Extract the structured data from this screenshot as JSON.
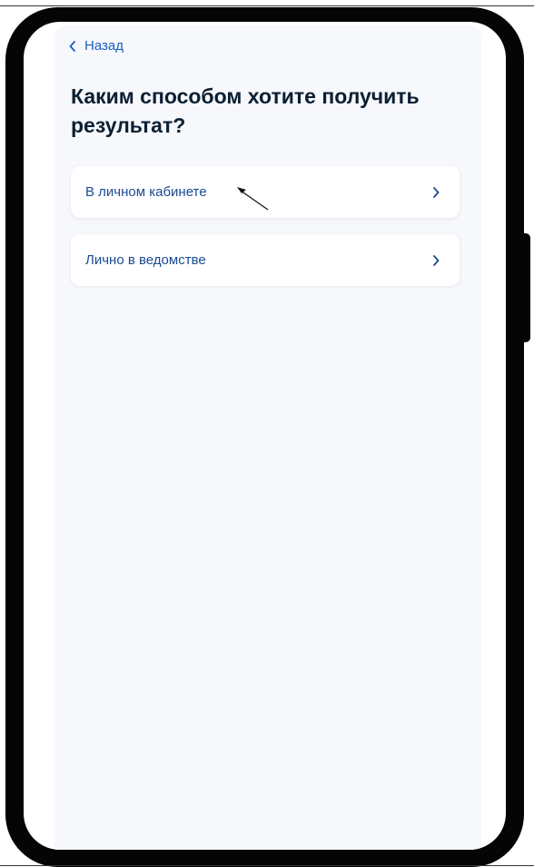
{
  "header": {
    "back_label": "Назад",
    "title": "Каким способом хотите получить результат?"
  },
  "options": [
    {
      "label": "В личном кабинете",
      "icon": "chevron-right-icon"
    },
    {
      "label": "Лично в ведомстве",
      "icon": "chevron-right-icon"
    }
  ],
  "icons": {
    "back": "chevron-left-icon",
    "cursor": "cursor-pointer-icon"
  },
  "colors": {
    "accent": "#1b5fc1",
    "option_text": "#1b4b91",
    "title": "#0b1f33",
    "background": "#f6f8fc",
    "card": "#ffffff",
    "device_frame": "#050505"
  }
}
